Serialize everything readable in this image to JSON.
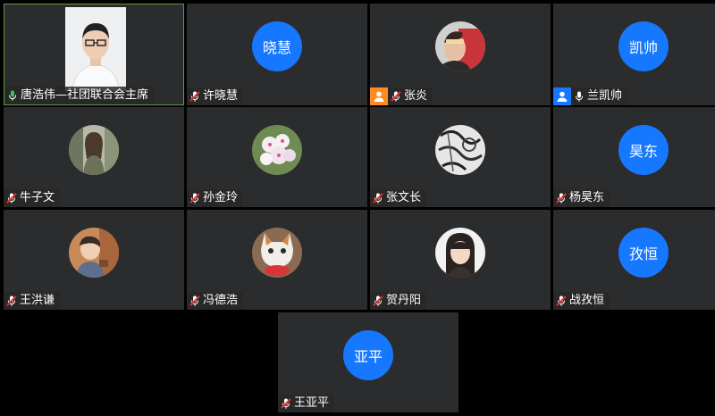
{
  "participants": [
    {
      "name": "唐浩伟—社团联合会主席",
      "avatar_type": "video",
      "mic": "on",
      "active_speaker": true
    },
    {
      "name": "许晓慧",
      "avatar_type": "text",
      "avatar_text": "晓慧",
      "mic": "muted"
    },
    {
      "name": "张炎",
      "avatar_type": "photo",
      "mic": "muted",
      "role": "host",
      "role_icon": "person-icon"
    },
    {
      "name": "兰凯帅",
      "avatar_type": "text",
      "avatar_text": "凯帅",
      "mic": "on",
      "role": "cohost",
      "role_icon": "person-icon"
    },
    {
      "name": "牛子文",
      "avatar_type": "photo",
      "mic": "muted"
    },
    {
      "name": "孙金玲",
      "avatar_type": "photo",
      "mic": "muted"
    },
    {
      "name": "张文长",
      "avatar_type": "photo",
      "mic": "muted"
    },
    {
      "name": "杨昊东",
      "avatar_type": "text",
      "avatar_text": "昊东",
      "mic": "muted"
    },
    {
      "name": "王洪谦",
      "avatar_type": "photo",
      "mic": "muted"
    },
    {
      "name": "冯德浩",
      "avatar_type": "photo",
      "mic": "muted"
    },
    {
      "name": "贺丹阳",
      "avatar_type": "photo",
      "mic": "muted"
    },
    {
      "name": "战孜恒",
      "avatar_type": "text",
      "avatar_text": "孜恒",
      "mic": "muted"
    },
    {
      "name": "王亚平",
      "avatar_type": "text",
      "avatar_text": "亚平",
      "mic": "muted"
    }
  ],
  "colors": {
    "tile_bg": "#2b2c2e",
    "avatar_blue": "#1677ff",
    "host_badge": "#ff8a1f",
    "mic_on": "#3cc25a",
    "mic_muted": "#e0332a",
    "active_border": "#5a9e3a"
  }
}
